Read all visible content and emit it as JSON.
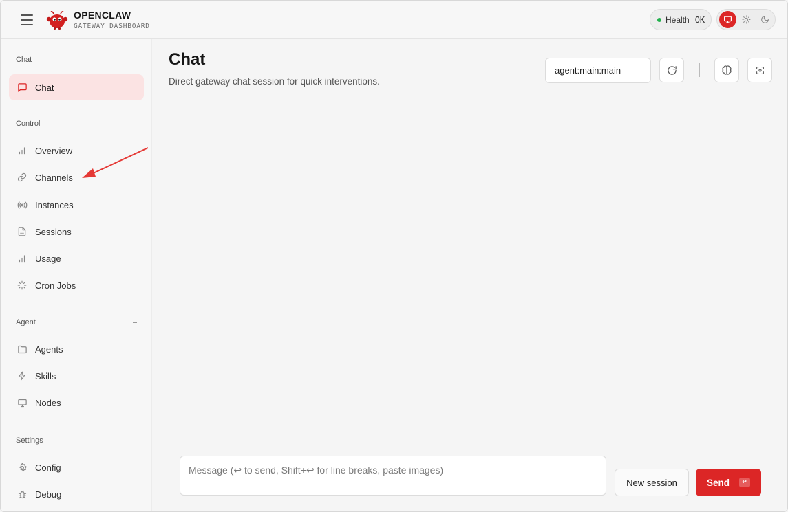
{
  "brand": {
    "title": "OPENCLAW",
    "subtitle": "GATEWAY DASHBOARD",
    "logo_icon": "lobster-mascot-icon"
  },
  "health": {
    "label": "Health",
    "value": "OK",
    "status_color": "#22b14c"
  },
  "theme": {
    "options": [
      "system-monitor-icon",
      "sun-icon",
      "moon-icon"
    ],
    "active": "system",
    "accent": "#dc2626"
  },
  "sidebar": {
    "sections": [
      {
        "title": "Chat",
        "items": [
          {
            "label": "Chat",
            "icon": "message-square-icon",
            "active": true
          }
        ]
      },
      {
        "title": "Control",
        "items": [
          {
            "label": "Overview",
            "icon": "bar-chart-icon"
          },
          {
            "label": "Channels",
            "icon": "link-icon"
          },
          {
            "label": "Instances",
            "icon": "radio-icon"
          },
          {
            "label": "Sessions",
            "icon": "file-text-icon"
          },
          {
            "label": "Usage",
            "icon": "bar-chart-icon"
          },
          {
            "label": "Cron Jobs",
            "icon": "loader-icon"
          }
        ]
      },
      {
        "title": "Agent",
        "items": [
          {
            "label": "Agents",
            "icon": "folder-icon"
          },
          {
            "label": "Skills",
            "icon": "zap-icon"
          },
          {
            "label": "Nodes",
            "icon": "monitor-icon"
          }
        ]
      },
      {
        "title": "Settings",
        "items": [
          {
            "label": "Config",
            "icon": "settings-icon"
          },
          {
            "label": "Debug",
            "icon": "bug-icon"
          }
        ]
      }
    ]
  },
  "main": {
    "title": "Chat",
    "subtitle": "Direct gateway chat session for quick interventions.",
    "session_key": "agent:main:main",
    "toolbar_icons": [
      "refresh-icon",
      "brain-icon",
      "focus-icon"
    ]
  },
  "composer": {
    "placeholder": "Message (↩ to send, Shift+↩ for line breaks, paste images)",
    "value": "",
    "new_session_label": "New session",
    "send_label": "Send",
    "send_shortcut": "↵"
  }
}
